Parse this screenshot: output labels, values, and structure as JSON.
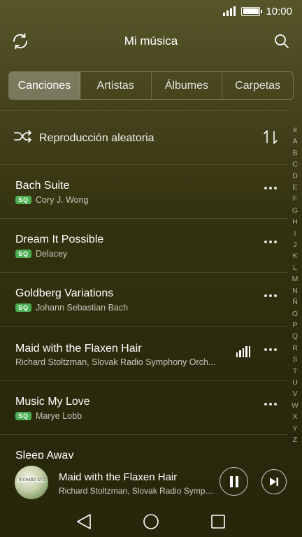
{
  "status_bar": {
    "time": "10:00"
  },
  "header": {
    "title": "Mi música"
  },
  "tabs": [
    {
      "label": "Canciones",
      "active": true
    },
    {
      "label": "Artistas",
      "active": false
    },
    {
      "label": "Álbumes",
      "active": false
    },
    {
      "label": "Carpetas",
      "active": false
    }
  ],
  "shuffle": {
    "label": "Reproducción aleatoria"
  },
  "badge": "SQ",
  "songs": [
    {
      "title": "Bach Suite",
      "artist": "Cory J. Wong",
      "badge": true,
      "playing": false
    },
    {
      "title": "Dream It Possible",
      "artist": "Delacey",
      "badge": true,
      "playing": false
    },
    {
      "title": "Goldberg Variations",
      "artist": "Johann Sebastian Bach",
      "badge": true,
      "playing": false
    },
    {
      "title": "Maid with the Flaxen Hair",
      "artist": "Richard Stoltzman, Slovak Radio Symphony Orch...",
      "badge": false,
      "playing": true
    },
    {
      "title": "Music My Love",
      "artist": "Marye Lobb",
      "badge": true,
      "playing": false
    },
    {
      "title": "Sleep Away",
      "artist": "",
      "badge": false,
      "playing": false
    }
  ],
  "alphabet": [
    "#",
    "A",
    "B",
    "C",
    "D",
    "E",
    "F",
    "G",
    "H",
    "I",
    "J",
    "K",
    "L",
    "M",
    "N",
    "Ñ",
    "O",
    "P",
    "Q",
    "R",
    "S",
    "T",
    "U",
    "V",
    "W",
    "X",
    "Y",
    "Z"
  ],
  "now_playing": {
    "title": "Maid with the Flaxen Hair",
    "artist": "Richard Stoltzman, Slovak Radio Symph...",
    "album_art_text": "RICHARD STOLTZMAN"
  },
  "colors": {
    "sq_badge": "#4cae52",
    "background": "#34330f"
  }
}
